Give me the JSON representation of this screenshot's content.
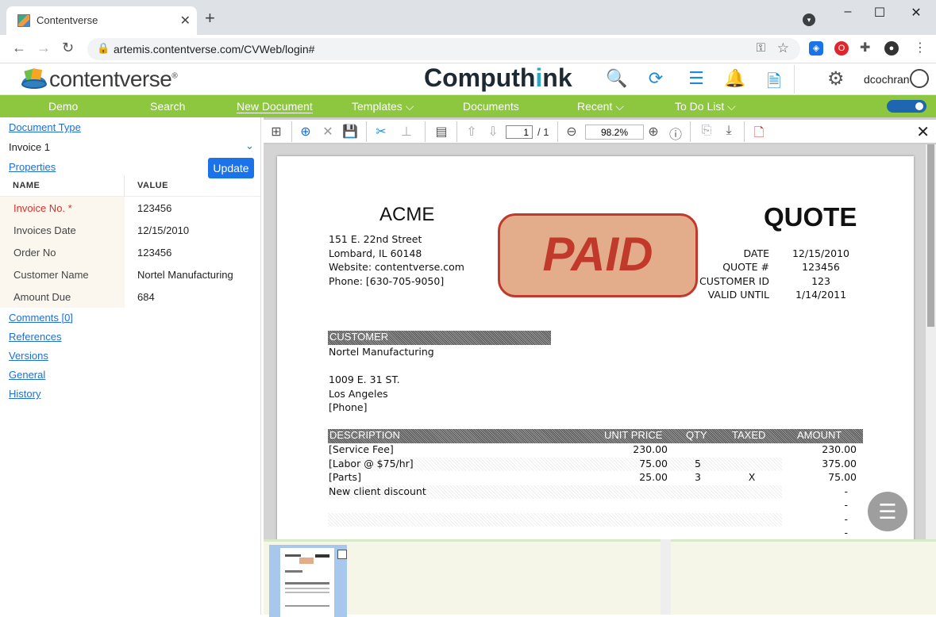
{
  "browser": {
    "tab_title": "Contentverse",
    "url": "artemis.contentverse.com/CVWeb/login#",
    "new_tab": "+",
    "window_controls": [
      "–",
      "☐",
      "✕"
    ]
  },
  "app": {
    "logo_text": "contentverse",
    "logo_mark": "®",
    "brand_left": "Compu",
    "brand_mid": "th",
    "brand_accent": "i",
    "brand_right": "nk",
    "username": "dcochran",
    "header_icons": [
      "search-icon",
      "refresh-icon",
      "list-icon",
      "bell-icon",
      "document-icon"
    ]
  },
  "nav": {
    "items": [
      {
        "label": "Demo"
      },
      {
        "label": "Search"
      },
      {
        "label": "New Document"
      },
      {
        "label": "Templates",
        "chevron": "⌵"
      },
      {
        "label": "Documents"
      },
      {
        "label": "Recent",
        "chevron": "⌵"
      },
      {
        "label": "To Do List",
        "chevron": "⌵"
      }
    ]
  },
  "left": {
    "document_type_label": "Document Type",
    "document_type_value": "Invoice 1",
    "properties_label": "Properties",
    "update_button": "Update",
    "table_headers": [
      "NAME",
      "VALUE"
    ],
    "properties": [
      {
        "name": "Invoice No. *",
        "value": "123456",
        "required": true
      },
      {
        "name": "Invoices Date",
        "value": "12/15/2010"
      },
      {
        "name": "Order No",
        "value": "123456"
      },
      {
        "name": "Customer Name",
        "value": "Nortel Manufacturing"
      },
      {
        "name": "Amount Due",
        "value": "684"
      }
    ],
    "links": [
      "Comments [0]",
      "References",
      "Versions",
      "General",
      "History"
    ]
  },
  "viewer": {
    "page_current": "1",
    "page_total": "/ 1",
    "zoom": "98.2%"
  },
  "document": {
    "company": "ACME",
    "doc_title": "QUOTE",
    "stamp": "PAID",
    "address": [
      "151 E. 22nd Street",
      "Lombard, IL 60148",
      "Website: contentverse.com",
      "Phone: [630-705-9050]"
    ],
    "meta": [
      {
        "label": "DATE",
        "value": "12/15/2010"
      },
      {
        "label": "QUOTE #",
        "value": "123456"
      },
      {
        "label": "CUSTOMER ID",
        "value": "123"
      },
      {
        "label": "VALID UNTIL",
        "value": "1/14/2011"
      }
    ],
    "customer_header": "CUSTOMER",
    "customer": [
      "Nortel Manufacturing",
      "",
      "1009 E. 31 ST.",
      "Los Angeles",
      "[Phone]"
    ],
    "line_headers": [
      "DESCRIPTION",
      "UNIT PRICE",
      "QTY",
      "TAXED",
      "AMOUNT"
    ],
    "lines": [
      {
        "desc": "[Service Fee]",
        "price": "230.00",
        "qty": "",
        "taxed": "",
        "amount": "230.00"
      },
      {
        "desc": "[Labor @ $75/hr]",
        "price": "75.00",
        "qty": "5",
        "taxed": "",
        "amount": "375.00"
      },
      {
        "desc": "[Parts]",
        "price": "25.00",
        "qty": "3",
        "taxed": "X",
        "amount": "75.00"
      },
      {
        "desc": "New client discount",
        "price": "",
        "qty": "",
        "taxed": "",
        "amount": "-"
      },
      {
        "desc": "",
        "price": "",
        "qty": "",
        "taxed": "",
        "amount": "-"
      },
      {
        "desc": "",
        "price": "",
        "qty": "",
        "taxed": "",
        "amount": "-"
      },
      {
        "desc": "",
        "price": "",
        "qty": "",
        "taxed": "",
        "amount": "-"
      }
    ]
  },
  "colors": {
    "nav_green": "#8dc63f",
    "link_blue": "#1f6fd1",
    "update_blue": "#1a73e8",
    "stamp_red": "#c0392b",
    "stamp_fill": "#e3ad8b"
  }
}
